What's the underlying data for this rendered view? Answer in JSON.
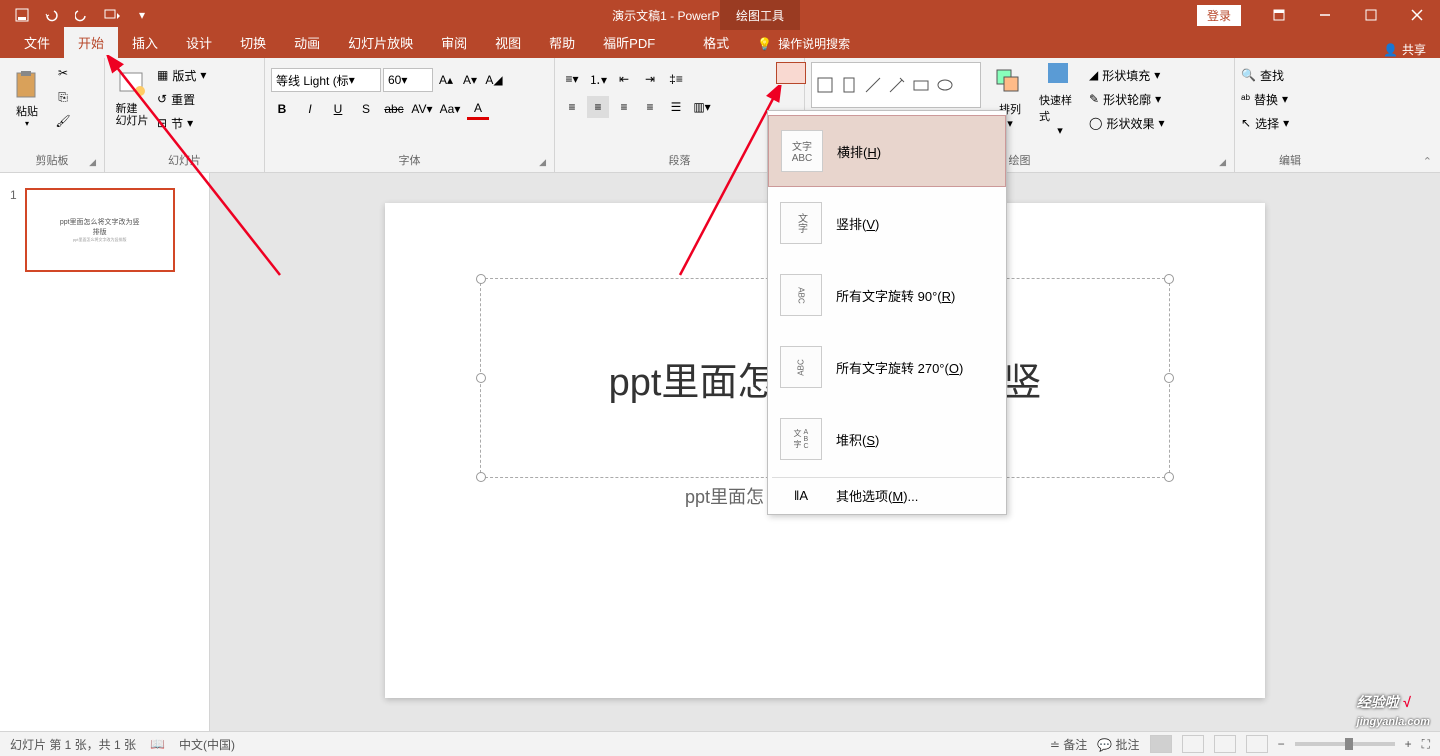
{
  "app": {
    "title": "演示文稿1 - PowerPoint",
    "context_tab": "绘图工具",
    "login": "登录"
  },
  "tabs": {
    "file": "文件",
    "home": "开始",
    "insert": "插入",
    "design": "设计",
    "transition": "切换",
    "animation": "动画",
    "slideshow": "幻灯片放映",
    "review": "审阅",
    "view": "视图",
    "help": "帮助",
    "foxit": "福昕PDF",
    "format": "格式",
    "tell_me": "操作说明搜索",
    "share": "共享"
  },
  "ribbon": {
    "clipboard": {
      "label": "剪贴板",
      "paste": "粘贴"
    },
    "slides": {
      "label": "幻灯片",
      "new_slide": "新建\n幻灯片",
      "layout": "版式",
      "reset": "重置",
      "section": "节"
    },
    "font": {
      "label": "字体",
      "name": "等线 Light (标",
      "size": "60"
    },
    "paragraph": {
      "label": "段落"
    },
    "drawing": {
      "label": "绘图",
      "arrange": "排列",
      "quick_style": "快速样式",
      "fill": "形状填充",
      "outline": "形状轮廓",
      "effects": "形状效果"
    },
    "editing": {
      "label": "编辑",
      "find": "查找",
      "replace": "替换",
      "select": "选择"
    }
  },
  "dropdown": {
    "horizontal": "横排(H)",
    "vertical": "竖排(V)",
    "rotate90": "所有文字旋转 90°(R)",
    "rotate270": "所有文字旋转 270°(O)",
    "stacked": "堆积(S)",
    "more": "其他选项(M)...",
    "icon_h1": "文字",
    "icon_h2": "ABC"
  },
  "slide": {
    "number": "1",
    "title": "ppt里面怎",
    "title_right": "改为竖",
    "subtitle": "ppt里面怎",
    "thumb_title": "ppt里面怎么将文字改为竖\n排版",
    "thumb_sub": "ppt里面怎么将文字改为竖排版"
  },
  "status": {
    "slide_info": "幻灯片 第 1 张，共 1 张",
    "lang": "中文(中国)",
    "notes": "备注",
    "comments": "批注"
  },
  "watermark": {
    "text1": "经验啦",
    "text2": "√",
    "url": "jingyanla.com"
  }
}
